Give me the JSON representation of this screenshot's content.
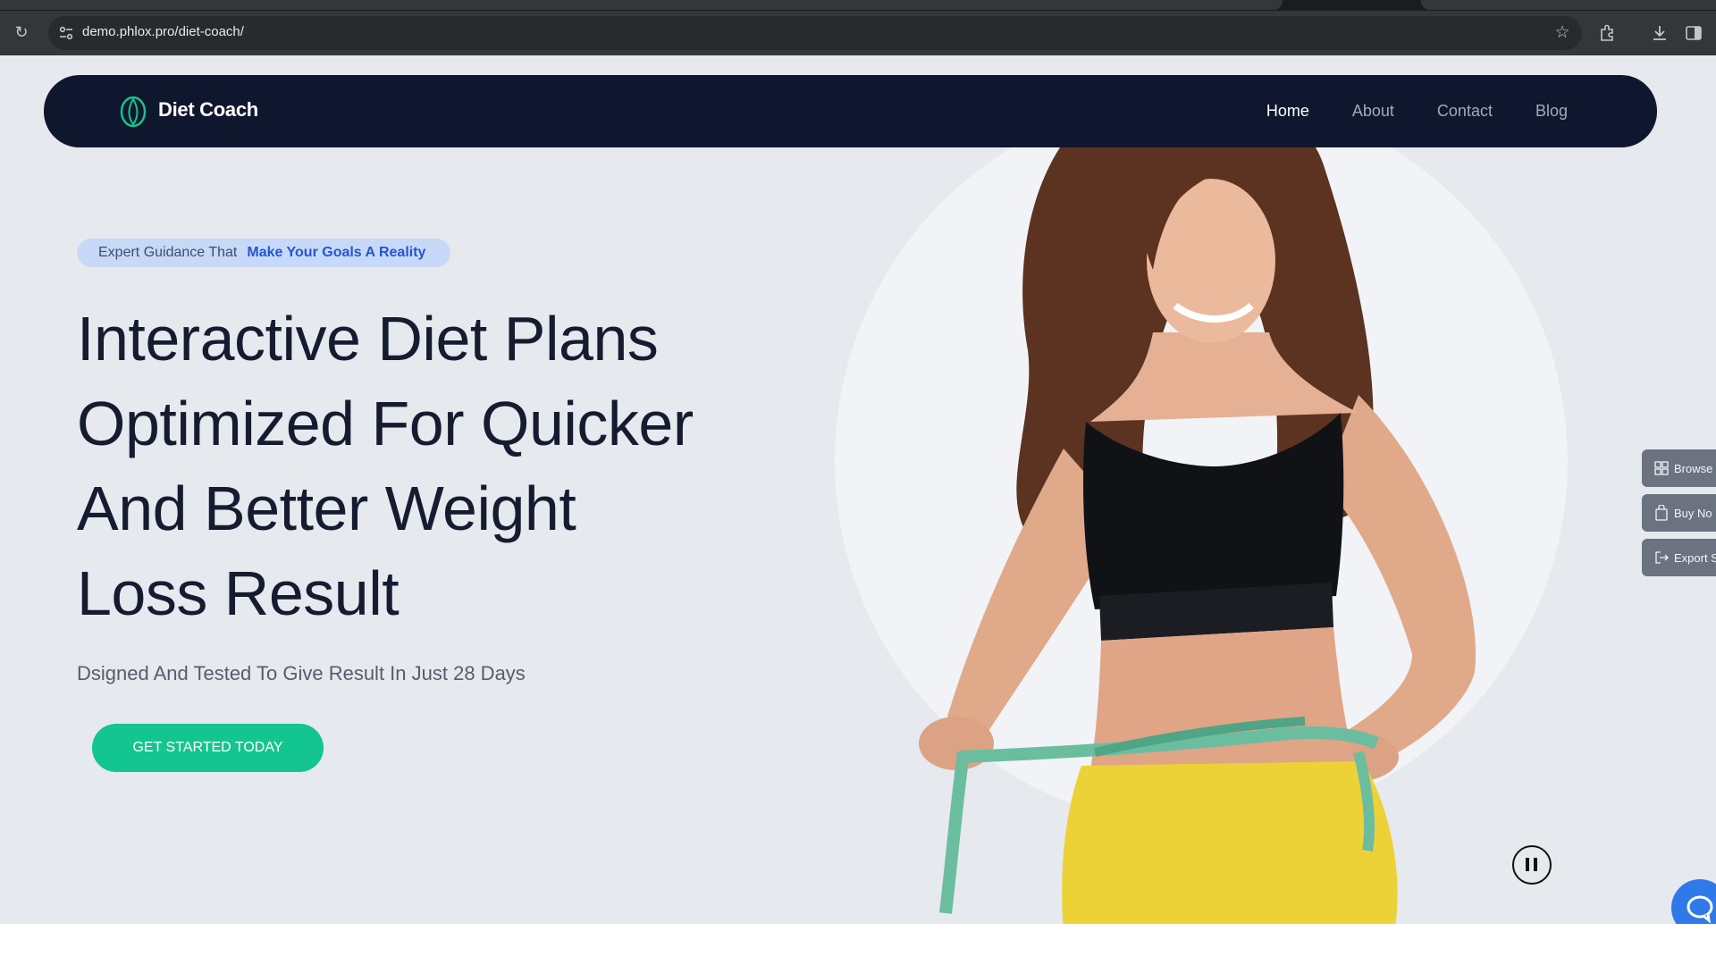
{
  "browser": {
    "url": "demo.phlox.pro/diet-coach/",
    "icons": [
      "reload-icon",
      "site-info-icon",
      "bookmark-star-icon",
      "extensions-icon",
      "download-icon",
      "side-panel-icon"
    ]
  },
  "nav": {
    "brand": "Diet Coach",
    "links": [
      "Home",
      "About",
      "Contact",
      "Blog"
    ],
    "active": "Home"
  },
  "hero": {
    "tagline_prefix": "Expert Guidance That",
    "tagline_highlight": "Make Your Goals A Reality",
    "headline_lines": [
      "Interactive Diet Plans",
      "Optimized For Quicker",
      "And Better Weight",
      "Loss Result"
    ],
    "subheadline": "Dsigned And Tested To Give Result In Just 28 Days",
    "cta": "GET STARTED TODAY"
  },
  "side_panel": [
    "Browse",
    "Buy No",
    "Export S"
  ],
  "colors": {
    "navbar": "#0f172e",
    "accent": "#13c58e",
    "tagline_bg": "#c8d9f8",
    "tagline_highlight": "#2456d6",
    "page_bg": "#e6e9ee"
  }
}
